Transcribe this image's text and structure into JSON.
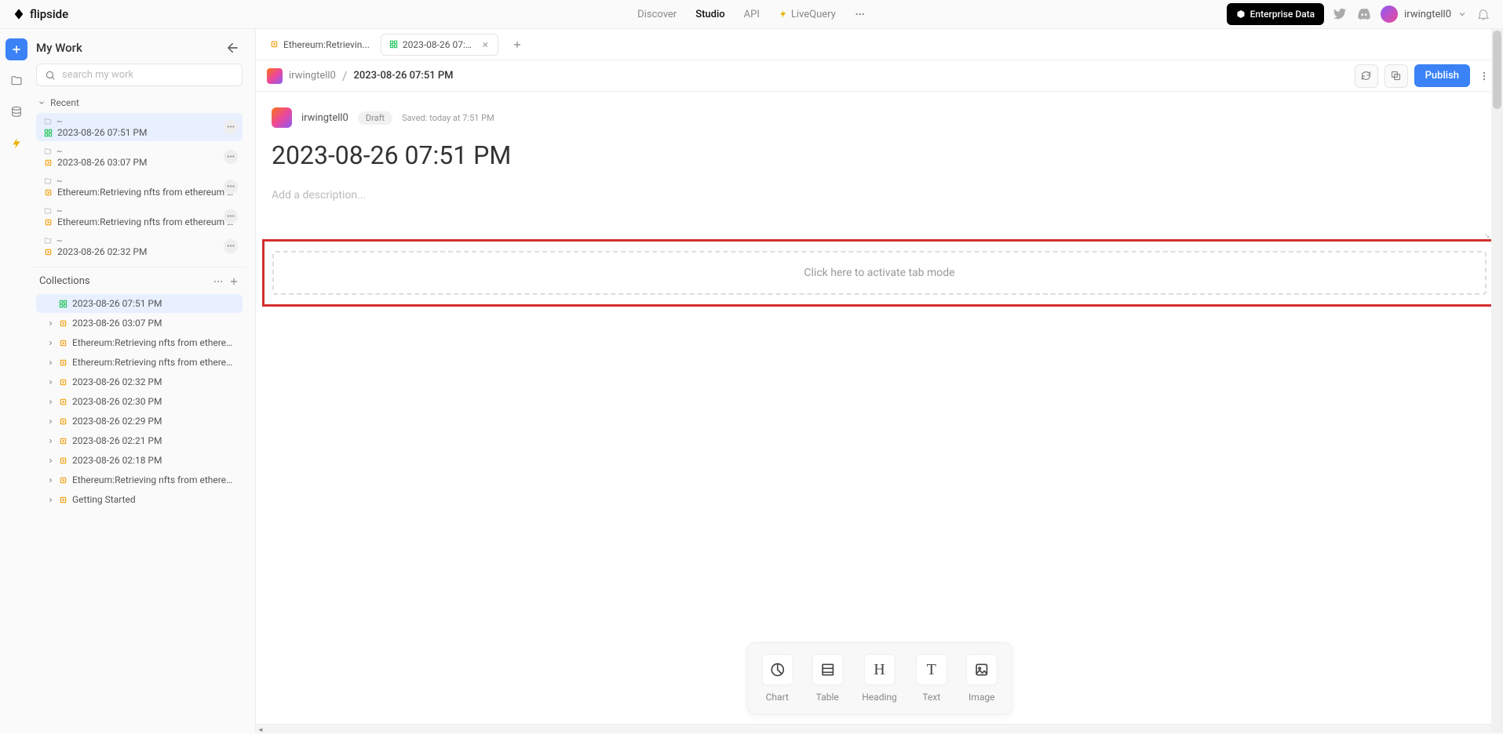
{
  "brand": "flipside",
  "nav": {
    "discover": "Discover",
    "studio": "Studio",
    "api": "API",
    "livequery": "LiveQuery"
  },
  "header": {
    "enterprise": "Enterprise Data",
    "username": "irwingtell0"
  },
  "sidebar": {
    "title": "My Work",
    "search_placeholder": "search my work",
    "recent_label": "Recent",
    "collections_label": "Collections",
    "recent": [
      {
        "path": "~",
        "name": "2023-08-26 07:51 PM",
        "type": "dashboard",
        "active": true
      },
      {
        "path": "~",
        "name": "2023-08-26 03:07 PM",
        "type": "query"
      },
      {
        "path": "~",
        "name": "Ethereum:Retrieving nfts from ethereum fr...",
        "type": "query"
      },
      {
        "path": "~",
        "name": "Ethereum:Retrieving nfts from ethereum fr...",
        "type": "query"
      },
      {
        "path": "~",
        "name": "2023-08-26 02:32 PM",
        "type": "query"
      }
    ],
    "collections": [
      {
        "name": "2023-08-26 07:51 PM",
        "type": "dashboard",
        "active": true,
        "expandable": false
      },
      {
        "name": "2023-08-26 03:07 PM",
        "type": "query",
        "expandable": true
      },
      {
        "name": "Ethereum:Retrieving nfts from ethereum...",
        "type": "query",
        "expandable": true
      },
      {
        "name": "Ethereum:Retrieving nfts from ethereum...",
        "type": "query",
        "expandable": true
      },
      {
        "name": "2023-08-26 02:32 PM",
        "type": "query",
        "expandable": true
      },
      {
        "name": "2023-08-26 02:30 PM",
        "type": "query",
        "expandable": true
      },
      {
        "name": "2023-08-26 02:29 PM",
        "type": "query",
        "expandable": true
      },
      {
        "name": "2023-08-26 02:21 PM",
        "type": "query",
        "expandable": true
      },
      {
        "name": "2023-08-26 02:18 PM",
        "type": "query",
        "expandable": true
      },
      {
        "name": "Ethereum:Retrieving nfts from ethereum...",
        "type": "query",
        "expandable": true
      },
      {
        "name": "Getting Started",
        "type": "query",
        "expandable": true
      }
    ]
  },
  "tabs": [
    {
      "label": "Ethereum:Retrievin...",
      "type": "query",
      "active": false,
      "closable": false
    },
    {
      "label": "2023-08-26 07:51 ...",
      "type": "dashboard",
      "active": true,
      "closable": true
    }
  ],
  "breadcrumb": {
    "user": "irwingtell0",
    "title": "2023-08-26 07:51 PM",
    "publish": "Publish"
  },
  "doc": {
    "username": "irwingtell0",
    "draft": "Draft",
    "saved": "Saved: today at 7:51 PM",
    "title": "2023-08-26 07:51 PM",
    "description_placeholder": "Add a description..."
  },
  "tabmode": "Click here to activate tab mode",
  "insert": {
    "chart": "Chart",
    "table": "Table",
    "heading": "Heading",
    "text": "Text",
    "image": "Image"
  }
}
